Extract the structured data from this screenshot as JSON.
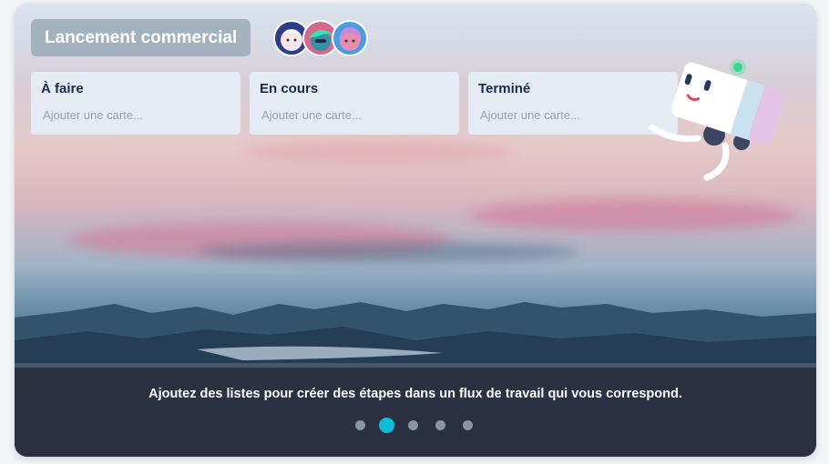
{
  "board": {
    "title": "Lancement commercial",
    "avatars": [
      {
        "name": "avatar-member-1",
        "icon": "cartoon-face-white-hair"
      },
      {
        "name": "avatar-member-2",
        "icon": "cartoon-face-green-hair"
      },
      {
        "name": "avatar-member-3",
        "icon": "cartoon-face-blonde-hair"
      }
    ]
  },
  "lists": [
    {
      "title": "À faire",
      "add_card": "Ajouter une carte..."
    },
    {
      "title": "En cours",
      "add_card": "Ajouter une carte..."
    },
    {
      "title": "Terminé",
      "add_card": "Ajouter une carte..."
    }
  ],
  "onboarding": {
    "caption": "Ajoutez des listes pour créer des étapes dans un flux de travail qui vous correspond.",
    "pagination": {
      "total": 5,
      "active_index": 2
    }
  },
  "colors": {
    "accent": "#0fbcd6",
    "list_bg": "#e4ebf3",
    "caption_bar": "#2a2e40"
  },
  "mascot": {
    "icon": "taco-robot-mascot"
  }
}
